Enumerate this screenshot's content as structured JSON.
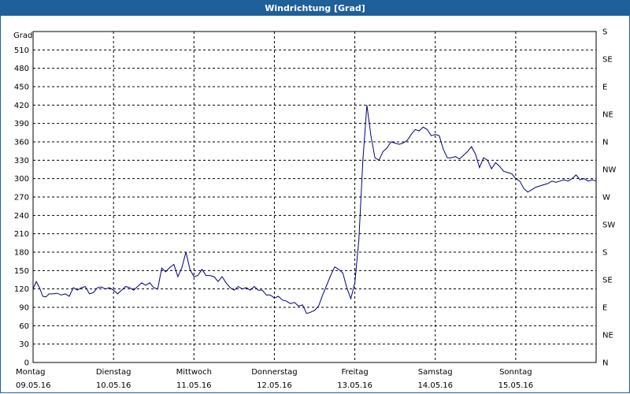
{
  "window": {
    "title": "Windrichtung [Grad]"
  },
  "chart_data": {
    "type": "line",
    "title": "Windrichtung [Grad]",
    "ylabel": "Grad",
    "ylim": [
      0,
      540
    ],
    "yticks": [
      0,
      30,
      60,
      90,
      120,
      150,
      180,
      210,
      240,
      270,
      300,
      330,
      360,
      390,
      420,
      450,
      480,
      510
    ],
    "y2ticks": [
      {
        "value": 0,
        "label": "N"
      },
      {
        "value": 45,
        "label": "NE"
      },
      {
        "value": 90,
        "label": "E"
      },
      {
        "value": 135,
        "label": "SE"
      },
      {
        "value": 180,
        "label": "S"
      },
      {
        "value": 225,
        "label": "SW"
      },
      {
        "value": 270,
        "label": "W"
      },
      {
        "value": 315,
        "label": "NW"
      },
      {
        "value": 360,
        "label": "N"
      },
      {
        "value": 405,
        "label": "NE"
      },
      {
        "value": 450,
        "label": "E"
      },
      {
        "value": 495,
        "label": "SE"
      },
      {
        "value": 540,
        "label": "S"
      }
    ],
    "xlim": [
      0,
      7
    ],
    "xticks": [
      {
        "value": 0,
        "day": "Montag",
        "date": "09.05.16"
      },
      {
        "value": 1,
        "day": "Dienstag",
        "date": "10.05.16"
      },
      {
        "value": 2,
        "day": "Mittwoch",
        "date": "11.05.16"
      },
      {
        "value": 3,
        "day": "Donnerstag",
        "date": "12.05.16"
      },
      {
        "value": 4,
        "day": "Freitag",
        "date": "13.05.16"
      },
      {
        "value": 5,
        "day": "Samstag",
        "date": "14.05.16"
      },
      {
        "value": 6,
        "day": "Sonntag",
        "date": "15.05.16"
      }
    ],
    "grid": true,
    "series": [
      {
        "color": "#00007f",
        "points": [
          [
            0.0,
            120
          ],
          [
            0.04,
            132
          ],
          [
            0.08,
            122
          ],
          [
            0.12,
            108
          ],
          [
            0.16,
            107
          ],
          [
            0.2,
            112
          ],
          [
            0.25,
            112
          ],
          [
            0.3,
            113
          ],
          [
            0.35,
            110
          ],
          [
            0.4,
            112
          ],
          [
            0.45,
            108
          ],
          [
            0.5,
            122
          ],
          [
            0.55,
            118
          ],
          [
            0.6,
            122
          ],
          [
            0.65,
            124
          ],
          [
            0.7,
            112
          ],
          [
            0.75,
            114
          ],
          [
            0.8,
            122
          ],
          [
            0.85,
            123
          ],
          [
            0.9,
            120
          ],
          [
            0.95,
            122
          ],
          [
            1.0,
            118
          ],
          [
            1.05,
            112
          ],
          [
            1.1,
            118
          ],
          [
            1.15,
            124
          ],
          [
            1.2,
            122
          ],
          [
            1.25,
            118
          ],
          [
            1.3,
            124
          ],
          [
            1.35,
            130
          ],
          [
            1.4,
            126
          ],
          [
            1.45,
            130
          ],
          [
            1.5,
            122
          ],
          [
            1.55,
            120
          ],
          [
            1.6,
            154
          ],
          [
            1.65,
            148
          ],
          [
            1.7,
            155
          ],
          [
            1.75,
            160
          ],
          [
            1.8,
            140
          ],
          [
            1.85,
            155
          ],
          [
            1.9,
            180
          ],
          [
            1.95,
            152
          ],
          [
            2.0,
            140
          ],
          [
            2.05,
            142
          ],
          [
            2.1,
            152
          ],
          [
            2.15,
            142
          ],
          [
            2.2,
            142
          ],
          [
            2.25,
            140
          ],
          [
            2.3,
            132
          ],
          [
            2.35,
            140
          ],
          [
            2.4,
            130
          ],
          [
            2.45,
            122
          ],
          [
            2.5,
            118
          ],
          [
            2.55,
            124
          ],
          [
            2.6,
            120
          ],
          [
            2.65,
            122
          ],
          [
            2.7,
            118
          ],
          [
            2.75,
            124
          ],
          [
            2.8,
            118
          ],
          [
            2.85,
            118
          ],
          [
            2.9,
            110
          ],
          [
            2.95,
            110
          ],
          [
            3.0,
            105
          ],
          [
            3.05,
            108
          ],
          [
            3.1,
            102
          ],
          [
            3.15,
            100
          ],
          [
            3.2,
            96
          ],
          [
            3.25,
            98
          ],
          [
            3.3,
            92
          ],
          [
            3.35,
            94
          ],
          [
            3.4,
            80
          ],
          [
            3.45,
            82
          ],
          [
            3.5,
            85
          ],
          [
            3.55,
            92
          ],
          [
            3.6,
            110
          ],
          [
            3.65,
            126
          ],
          [
            3.7,
            142
          ],
          [
            3.75,
            156
          ],
          [
            3.8,
            152
          ],
          [
            3.85,
            146
          ],
          [
            3.9,
            122
          ],
          [
            3.95,
            104
          ],
          [
            4.0,
            130
          ],
          [
            4.05,
            200
          ],
          [
            4.1,
            330
          ],
          [
            4.15,
            420
          ],
          [
            4.2,
            370
          ],
          [
            4.25,
            334
          ],
          [
            4.3,
            330
          ],
          [
            4.35,
            344
          ],
          [
            4.4,
            350
          ],
          [
            4.45,
            360
          ],
          [
            4.5,
            358
          ],
          [
            4.55,
            356
          ],
          [
            4.6,
            358
          ],
          [
            4.65,
            362
          ],
          [
            4.7,
            372
          ],
          [
            4.75,
            380
          ],
          [
            4.8,
            378
          ],
          [
            4.85,
            384
          ],
          [
            4.9,
            380
          ],
          [
            4.95,
            370
          ],
          [
            5.0,
            372
          ],
          [
            5.05,
            370
          ],
          [
            5.1,
            348
          ],
          [
            5.15,
            334
          ],
          [
            5.2,
            334
          ],
          [
            5.25,
            336
          ],
          [
            5.3,
            332
          ],
          [
            5.35,
            338
          ],
          [
            5.4,
            344
          ],
          [
            5.45,
            352
          ],
          [
            5.5,
            340
          ],
          [
            5.55,
            318
          ],
          [
            5.6,
            334
          ],
          [
            5.65,
            330
          ],
          [
            5.7,
            316
          ],
          [
            5.75,
            326
          ],
          [
            5.8,
            320
          ],
          [
            5.85,
            312
          ],
          [
            5.9,
            310
          ],
          [
            5.95,
            308
          ],
          [
            6.0,
            300
          ],
          [
            6.05,
            296
          ],
          [
            6.1,
            284
          ],
          [
            6.15,
            278
          ],
          [
            6.2,
            282
          ],
          [
            6.25,
            286
          ],
          [
            6.3,
            288
          ],
          [
            6.35,
            290
          ],
          [
            6.4,
            292
          ],
          [
            6.45,
            296
          ],
          [
            6.5,
            294
          ],
          [
            6.55,
            296
          ],
          [
            6.6,
            298
          ],
          [
            6.65,
            296
          ],
          [
            6.7,
            300
          ],
          [
            6.75,
            306
          ],
          [
            6.8,
            298
          ],
          [
            6.85,
            300
          ],
          [
            6.9,
            296
          ],
          [
            6.95,
            298
          ],
          [
            7.0,
            296
          ]
        ]
      }
    ]
  }
}
